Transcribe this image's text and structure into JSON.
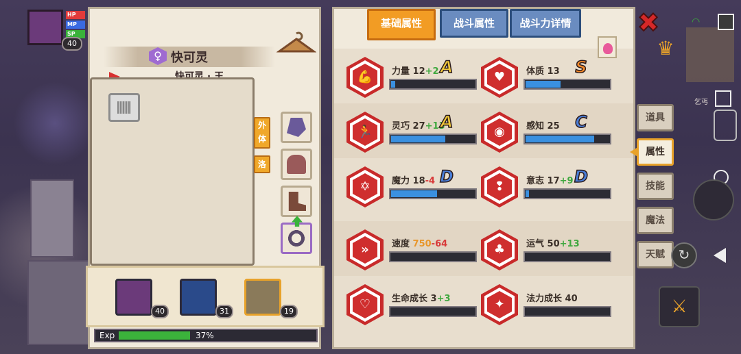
{
  "hud": {
    "hp_label": "HP",
    "mp_label": "MP",
    "sp_label": "SP",
    "level": "40",
    "hp_color": "#e23a3a",
    "mp_color": "#3a6ae2",
    "sp_color": "#3ab23a"
  },
  "character": {
    "gender_icon": "female-icon",
    "name": "快可灵",
    "subname": "快可灵 · 王",
    "tags": [
      "外\n体",
      "洛"
    ]
  },
  "party": [
    {
      "level": "40",
      "portrait": "demon-warrior-portrait"
    },
    {
      "level": "31",
      "portrait": "blue-beast-portrait"
    },
    {
      "level": "19",
      "portrait": "rock-golem-portrait"
    }
  ],
  "exp": {
    "label": "Exp",
    "percent_text": "37%",
    "percent": 37
  },
  "tabs": [
    {
      "label": "基础属性",
      "active": true
    },
    {
      "label": "战斗属性",
      "active": false
    },
    {
      "label": "战斗力详情",
      "active": false
    }
  ],
  "stats": [
    {
      "name": "力量",
      "base": "12",
      "bonus": "+2",
      "bonus_type": "pos",
      "grade": "A",
      "grade_color": "#f2c93a",
      "fill": 0.05,
      "icon": "strength-icon"
    },
    {
      "name": "体质",
      "base": "13",
      "bonus": "",
      "bonus_type": "none",
      "grade": "S",
      "grade_color": "#f58a2a",
      "fill": 0.42,
      "icon": "constitution-icon"
    },
    {
      "name": "灵巧",
      "base": "27",
      "bonus": "+13",
      "bonus_type": "pos",
      "grade": "A",
      "grade_color": "#f2c93a",
      "fill": 0.65,
      "icon": "dexterity-icon"
    },
    {
      "name": "感知",
      "base": "25",
      "bonus": "",
      "bonus_type": "none",
      "grade": "C",
      "grade_color": "#4a7ed8",
      "fill": 0.82,
      "icon": "perception-icon"
    },
    {
      "name": "魔力",
      "base": "18",
      "bonus": "-4",
      "bonus_type": "neg",
      "grade": "D",
      "grade_color": "#4a7ed8",
      "fill": 0.55,
      "icon": "magic-icon"
    },
    {
      "name": "意志",
      "base": "17",
      "bonus": "+9",
      "bonus_type": "pos",
      "grade": "D",
      "grade_color": "#4a7ed8",
      "fill": 0.04,
      "icon": "will-icon"
    },
    {
      "name": "速度",
      "base": "750",
      "bonus": "-64",
      "bonus_type": "neg",
      "grade": "",
      "grade_color": "",
      "fill": 0,
      "icon": "speed-icon",
      "base_orange": true
    },
    {
      "name": "运气",
      "base": "50",
      "bonus": "+13",
      "bonus_type": "pos",
      "grade": "",
      "grade_color": "",
      "fill": 0,
      "icon": "luck-icon"
    },
    {
      "name": "生命成长",
      "base": "3",
      "bonus": "+3",
      "bonus_type": "pos",
      "grade": "",
      "grade_color": "",
      "fill": 0,
      "icon": "life-growth-icon"
    },
    {
      "name": "法力成长",
      "base": "40",
      "bonus": "",
      "bonus_type": "none",
      "grade": "",
      "grade_color": "",
      "fill": 0,
      "icon": "mana-growth-icon"
    }
  ],
  "side_menu": [
    {
      "label": "道具",
      "active": false
    },
    {
      "label": "属性",
      "active": true
    },
    {
      "label": "技能",
      "active": false
    },
    {
      "label": "魔法",
      "active": false
    },
    {
      "label": "天赋",
      "active": false
    }
  ],
  "right_hud": {
    "note": "乞丐"
  },
  "colors": {
    "accent": "#f29c24",
    "tab_inactive": "#6a8cc0",
    "bar_fill": "#3a90e0",
    "hex_red": "#c82a2a"
  }
}
